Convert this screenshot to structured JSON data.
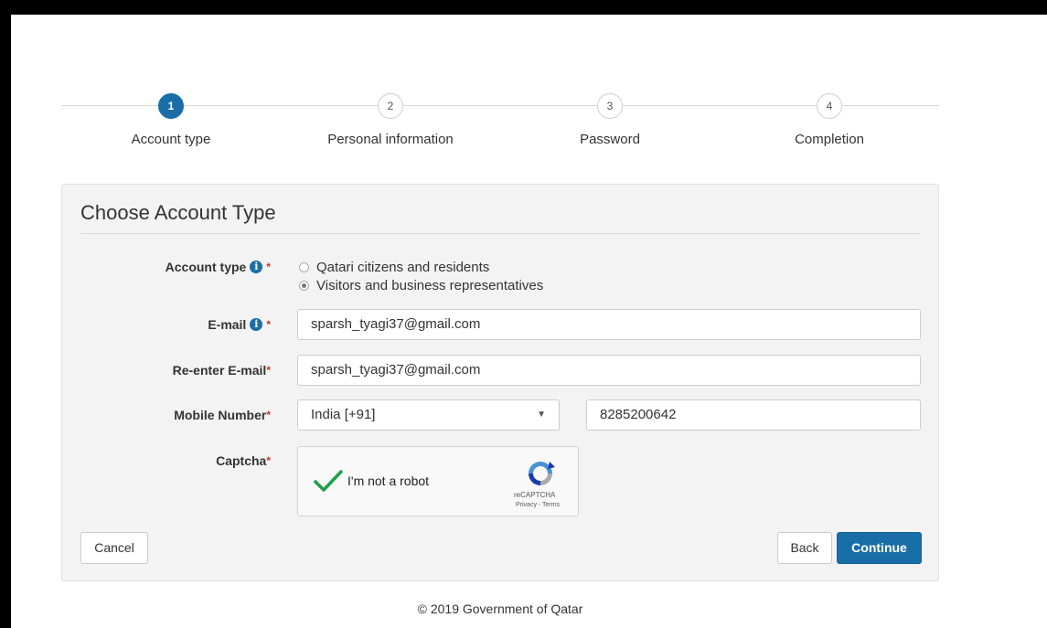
{
  "steps": [
    {
      "number": "1",
      "label": "Account type"
    },
    {
      "number": "2",
      "label": "Personal information"
    },
    {
      "number": "3",
      "label": "Password"
    },
    {
      "number": "4",
      "label": "Completion"
    }
  ],
  "active_step": 1,
  "panel": {
    "title": "Choose Account Type"
  },
  "form": {
    "account_type_label": "Account type",
    "account_type_options": [
      {
        "label": "Qatari citizens and residents",
        "checked": false
      },
      {
        "label": "Visitors and business representatives",
        "checked": true
      }
    ],
    "email_label": "E-mail",
    "email_value": "sparsh_tyagi37@gmail.com",
    "reemail_label": "Re-enter E-mail",
    "reemail_value": "sparsh_tyagi37@gmail.com",
    "mobile_label": "Mobile Number",
    "country_value": "India [+91]",
    "mobile_value": "8285200642",
    "captcha_label": "Captcha",
    "required_mark": "*",
    "info_glyph": "i"
  },
  "captcha": {
    "text": "I'm not a robot",
    "brand": "reCAPTCHA",
    "links": "Privacy - Terms",
    "checked": true
  },
  "buttons": {
    "cancel": "Cancel",
    "back": "Back",
    "continue": "Continue"
  },
  "footer": "© 2019 Government of Qatar",
  "colors": {
    "primary": "#1a6ea8",
    "required": "#c0392b",
    "check": "#1e9e4a"
  }
}
